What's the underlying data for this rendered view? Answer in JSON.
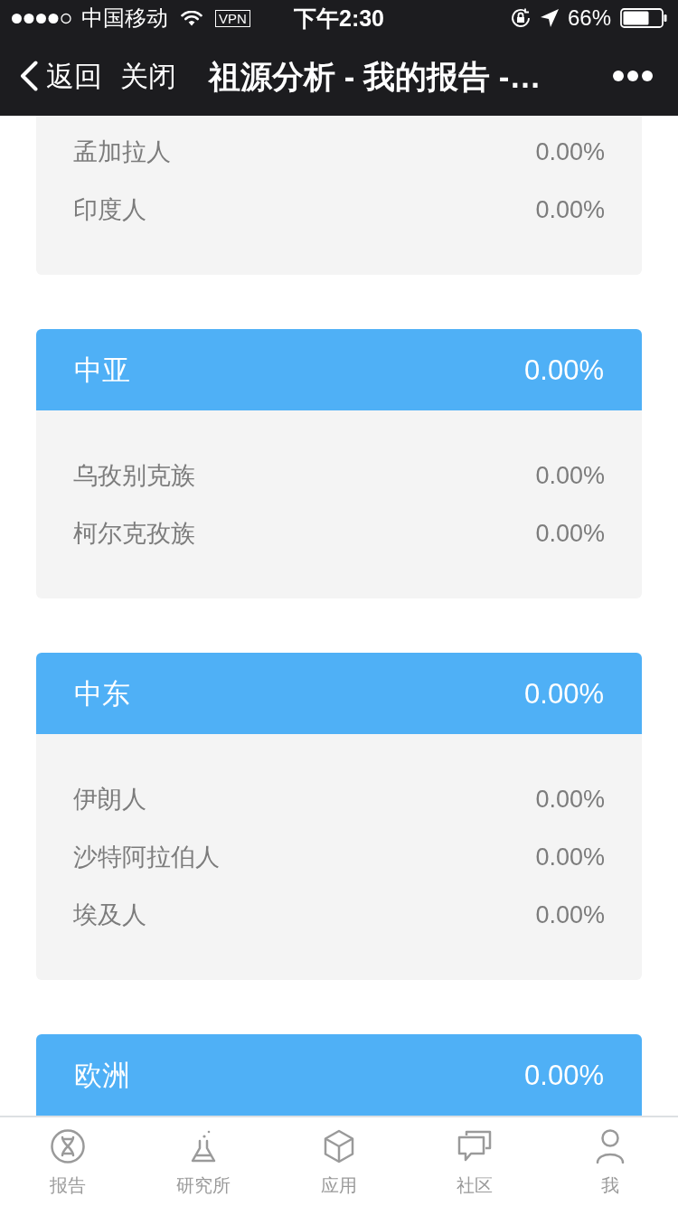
{
  "status_bar": {
    "carrier": "中国移动",
    "vpn": "VPN",
    "time": "下午2:30",
    "battery_percent": "66%"
  },
  "nav_bar": {
    "back": "返回",
    "close": "关闭",
    "title": "祖源分析 - 我的报告 -…"
  },
  "groups": [
    {
      "rows": [
        {
          "name": "孟加拉人",
          "percent": "0.00%"
        },
        {
          "name": "印度人",
          "percent": "0.00%"
        }
      ]
    },
    {
      "name": "中亚",
      "percent": "0.00%",
      "rows": [
        {
          "name": "乌孜别克族",
          "percent": "0.00%"
        },
        {
          "name": "柯尔克孜族",
          "percent": "0.00%"
        }
      ]
    },
    {
      "name": "中东",
      "percent": "0.00%",
      "rows": [
        {
          "name": "伊朗人",
          "percent": "0.00%"
        },
        {
          "name": "沙特阿拉伯人",
          "percent": "0.00%"
        },
        {
          "name": "埃及人",
          "percent": "0.00%"
        }
      ]
    },
    {
      "name": "欧洲",
      "percent": "0.00%"
    }
  ],
  "tabs": [
    {
      "label": "报告",
      "selected": false
    },
    {
      "label": "研究所",
      "selected": false
    },
    {
      "label": "应用",
      "selected": false
    },
    {
      "label": "社区",
      "selected": false
    },
    {
      "label": "我",
      "selected": false
    }
  ]
}
